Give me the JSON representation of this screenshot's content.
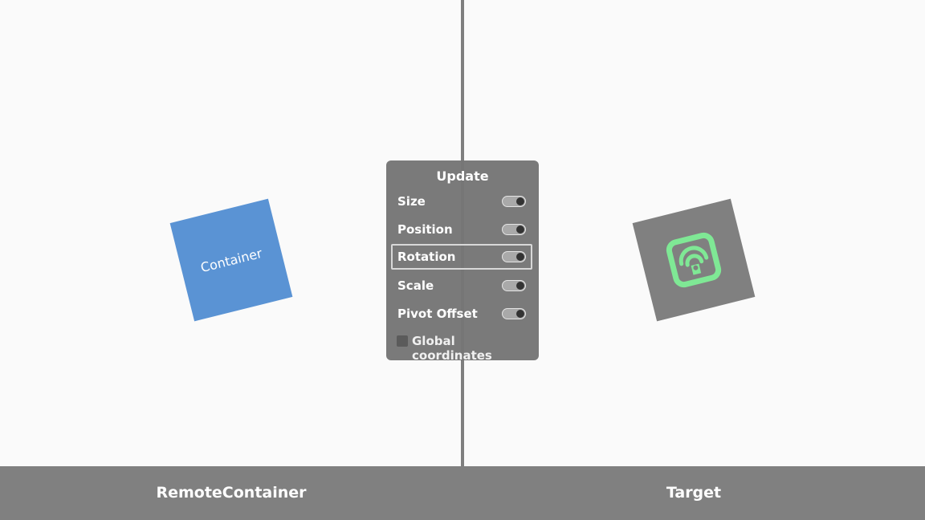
{
  "colors": {
    "background": "#fafafa",
    "container": "#5a93d4",
    "target": "#808080",
    "icon": "#7fe895",
    "panel": "#767676",
    "footer": "#808080"
  },
  "scene": {
    "container_label": "Container",
    "target_icon": "remote-signal-icon"
  },
  "panel": {
    "title": "Update",
    "options": [
      {
        "label": "Size",
        "enabled": true
      },
      {
        "label": "Position",
        "enabled": true
      },
      {
        "label": "Rotation",
        "enabled": true,
        "focused": true
      },
      {
        "label": "Scale",
        "enabled": true
      },
      {
        "label": "Pivot Offset",
        "enabled": true
      }
    ],
    "global_coordinates": {
      "label": "Global coordinates",
      "checked": false
    }
  },
  "footer": {
    "left_label": "RemoteContainer",
    "right_label": "Target"
  }
}
